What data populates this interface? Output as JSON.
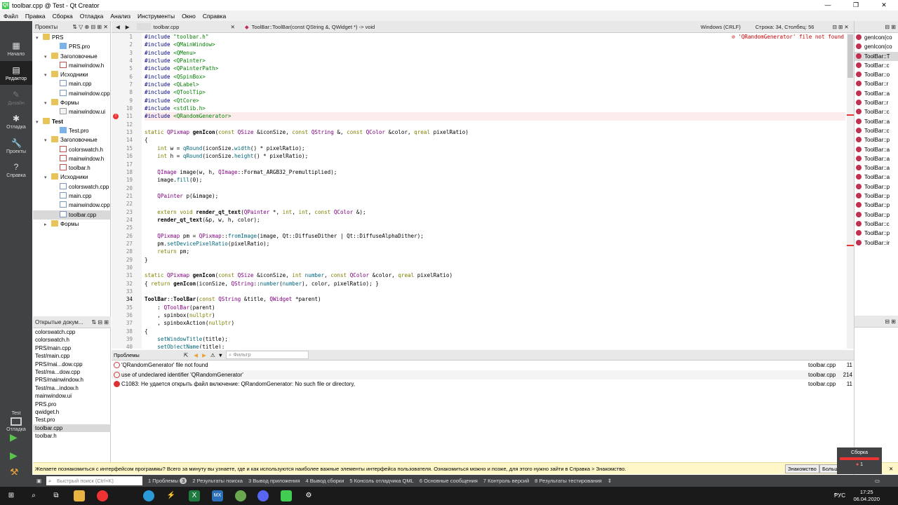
{
  "window": {
    "title": "toolbar.cpp @ Test - Qt Creator",
    "controls": [
      "—",
      "❐",
      "✕"
    ]
  },
  "menu": [
    "Файл",
    "Правка",
    "Сборка",
    "Отладка",
    "Анализ",
    "Инструменты",
    "Окно",
    "Справка"
  ],
  "modes": [
    {
      "label": "Начало",
      "icon": "▦"
    },
    {
      "label": "Редактор",
      "icon": "▤"
    },
    {
      "label": "Дизайн",
      "icon": "✎"
    },
    {
      "label": "Отладка",
      "icon": "✱"
    },
    {
      "label": "Проекты",
      "icon": "🔧"
    },
    {
      "label": "Справка",
      "icon": "?"
    }
  ],
  "kit": {
    "name": "Test",
    "label": "Отладка"
  },
  "projects": {
    "header": "Проекты",
    "tree": [
      {
        "label": "PRS",
        "indent": 0,
        "arrow": "▾",
        "icon": "folder",
        "bold": false
      },
      {
        "label": "PRS.pro",
        "indent": 2,
        "arrow": "",
        "icon": "pro"
      },
      {
        "label": "Заголовочные",
        "indent": 1,
        "arrow": "▾",
        "icon": "folder"
      },
      {
        "label": "mainwindow.h",
        "indent": 2,
        "arrow": "",
        "icon": "h"
      },
      {
        "label": "Исходники",
        "indent": 1,
        "arrow": "▾",
        "icon": "folder"
      },
      {
        "label": "main.cpp",
        "indent": 2,
        "arrow": "",
        "icon": "file"
      },
      {
        "label": "mainwindow.cpp",
        "indent": 2,
        "arrow": "",
        "icon": "file"
      },
      {
        "label": "Формы",
        "indent": 1,
        "arrow": "▾",
        "icon": "folder"
      },
      {
        "label": "mainwindow.ui",
        "indent": 2,
        "arrow": "",
        "icon": "ui"
      },
      {
        "label": "Test",
        "indent": 0,
        "arrow": "▾",
        "icon": "folder",
        "bold": true
      },
      {
        "label": "Test.pro",
        "indent": 2,
        "arrow": "",
        "icon": "pro"
      },
      {
        "label": "Заголовочные",
        "indent": 1,
        "arrow": "▾",
        "icon": "folder"
      },
      {
        "label": "colorswatch.h",
        "indent": 2,
        "arrow": "",
        "icon": "h"
      },
      {
        "label": "mainwindow.h",
        "indent": 2,
        "arrow": "",
        "icon": "h"
      },
      {
        "label": "toolbar.h",
        "indent": 2,
        "arrow": "",
        "icon": "h"
      },
      {
        "label": "Исходники",
        "indent": 1,
        "arrow": "▾",
        "icon": "folder"
      },
      {
        "label": "colorswatch.cpp",
        "indent": 2,
        "arrow": "",
        "icon": "file"
      },
      {
        "label": "main.cpp",
        "indent": 2,
        "arrow": "",
        "icon": "file"
      },
      {
        "label": "mainwindow.cpp",
        "indent": 2,
        "arrow": "",
        "icon": "file"
      },
      {
        "label": "toolbar.cpp",
        "indent": 2,
        "arrow": "",
        "icon": "file",
        "selected": true
      },
      {
        "label": "Формы",
        "indent": 1,
        "arrow": "▸",
        "icon": "folder"
      }
    ]
  },
  "open_docs": {
    "header": "Открытые докум...",
    "items": [
      "colorswatch.cpp",
      "colorswatch.h",
      "PRS/main.cpp",
      "Test/main.cpp",
      "PRS/mai...dow.cpp",
      "Test/ma...dow.cpp",
      "PRS/mainwindow.h",
      "Test/ma...indow.h",
      "mainwindow.ui",
      "PRS.pro",
      "qwidget.h",
      "Test.pro",
      "toolbar.cpp",
      "toolbar.h"
    ],
    "selected": "toolbar.cpp"
  },
  "editor_toolbar": {
    "file": "toolbar.cpp",
    "symbol": "ToolBar::ToolBar(const QString &, QWidget *) -> void",
    "encoding": "Windows (CRLF)",
    "position": "Строка: 34, Столбец: 56"
  },
  "code": {
    "lines": [
      "1",
      "2",
      "3",
      "4",
      "5",
      "6",
      "7",
      "8",
      "9",
      "10",
      "11",
      "12",
      "13",
      "14",
      "15",
      "16",
      "17",
      "18",
      "19",
      "20",
      "21",
      "22",
      "23",
      "24",
      "25",
      "26",
      "27",
      "28",
      "29",
      "30",
      "31",
      "32",
      "33",
      "34",
      "35",
      "36",
      "37",
      "38",
      "39",
      "40"
    ],
    "error_line": "11",
    "current_line": "34",
    "error_text": "'QRandomGenerator' file not found",
    "src": [
      "#include \"toolbar.h\"",
      "#include <QMainWindow>",
      "#include <QMenu>",
      "#include <QPainter>",
      "#include <QPainterPath>",
      "#include <QSpinBox>",
      "#include <QLabel>",
      "#include <QToolTip>",
      "#include <QtCore>",
      "#include <stdlib.h>",
      "#include <QRandomGenerator>",
      "",
      "static QPixmap genIcon(const QSize &iconSize, const QString &, const QColor &color, qreal pixelRatio)",
      "{",
      "    int w = qRound(iconSize.width() * pixelRatio);",
      "    int h = qRound(iconSize.height() * pixelRatio);",
      "",
      "    QImage image(w, h, QImage::Format_ARGB32_Premultiplied);",
      "    image.fill(0);",
      "",
      "    QPainter p(&image);",
      "",
      "    extern void render_qt_text(QPainter *, int, int, const QColor &);",
      "    render_qt_text(&p, w, h, color);",
      "",
      "    QPixmap pm = QPixmap::fromImage(image, Qt::DiffuseDither | Qt::DiffuseAlphaDither);",
      "    pm.setDevicePixelRatio(pixelRatio);",
      "    return pm;",
      "}",
      "",
      "static QPixmap genIcon(const QSize &iconSize, int number, const QColor &color, qreal pixelRatio)",
      "{ return genIcon(iconSize, QString::number(number), color, pixelRatio); }",
      "",
      "ToolBar::ToolBar(const QString &title, QWidget *parent)",
      "    : QToolBar(parent)",
      "    , spinbox(nullptr)",
      "    , spinboxAction(nullptr)",
      "{",
      "    setWindowTitle(title);",
      "    setObjectName(title);"
    ]
  },
  "outline": [
    "genIcon(co",
    "genIcon(co",
    "ToolBar::T",
    "ToolBar::c",
    "ToolBar::o",
    "ToolBar::r",
    "ToolBar::a",
    "ToolBar::r",
    "ToolBar::c",
    "ToolBar::a",
    "ToolBar::c",
    "ToolBar::p",
    "ToolBar::a",
    "ToolBar::a",
    "ToolBar::a",
    "ToolBar::a",
    "ToolBar::p",
    "ToolBar::p",
    "ToolBar::p",
    "ToolBar::p",
    "ToolBar::c",
    "ToolBar::p",
    "ToolBar::ir"
  ],
  "problems": {
    "header": "Проблемы",
    "filter_placeholder": "Фильтр",
    "rows": [
      {
        "text": "'QRandomGenerator' file not found",
        "file": "toolbar.cpp",
        "line": "11",
        "filled": false
      },
      {
        "text": "use of undeclared identifier 'QRandomGenerator'",
        "file": "toolbar.cpp",
        "line": "214",
        "filled": false
      },
      {
        "text": "C1083: Не удается открыть файл включение: QRandomGenerator: No such file or directory,",
        "file": "toolbar.cpp",
        "line": "11",
        "filled": true
      }
    ]
  },
  "infobar": {
    "text": "Желаете познакомиться с интерфейсом программы? Всего за минуту вы узнаете, где и как используются наиболее важные элементы интерфейса пользователя. Ознакомиться можно и позже, для этого нужно зайти в Справка > Знакомство.",
    "btn1": "Знакомство",
    "btn2": "Больш"
  },
  "build": {
    "label": "Сборка",
    "count": "1"
  },
  "statusbar": {
    "search_placeholder": "Быстрый поиск (Ctrl+K)",
    "problems_badge": "3",
    "tabs": [
      "1 Проблемы",
      "2 Результаты поиска",
      "3 Вывод приложения",
      "4 Вывод сборки",
      "5 Консоль отладчика QML",
      "6 Основные сообщения",
      "7 Контроль версий",
      "8 Результаты тестирования"
    ]
  },
  "taskbar": {
    "lang": "РУС",
    "time": "17:25",
    "date": "06.04.2020"
  }
}
